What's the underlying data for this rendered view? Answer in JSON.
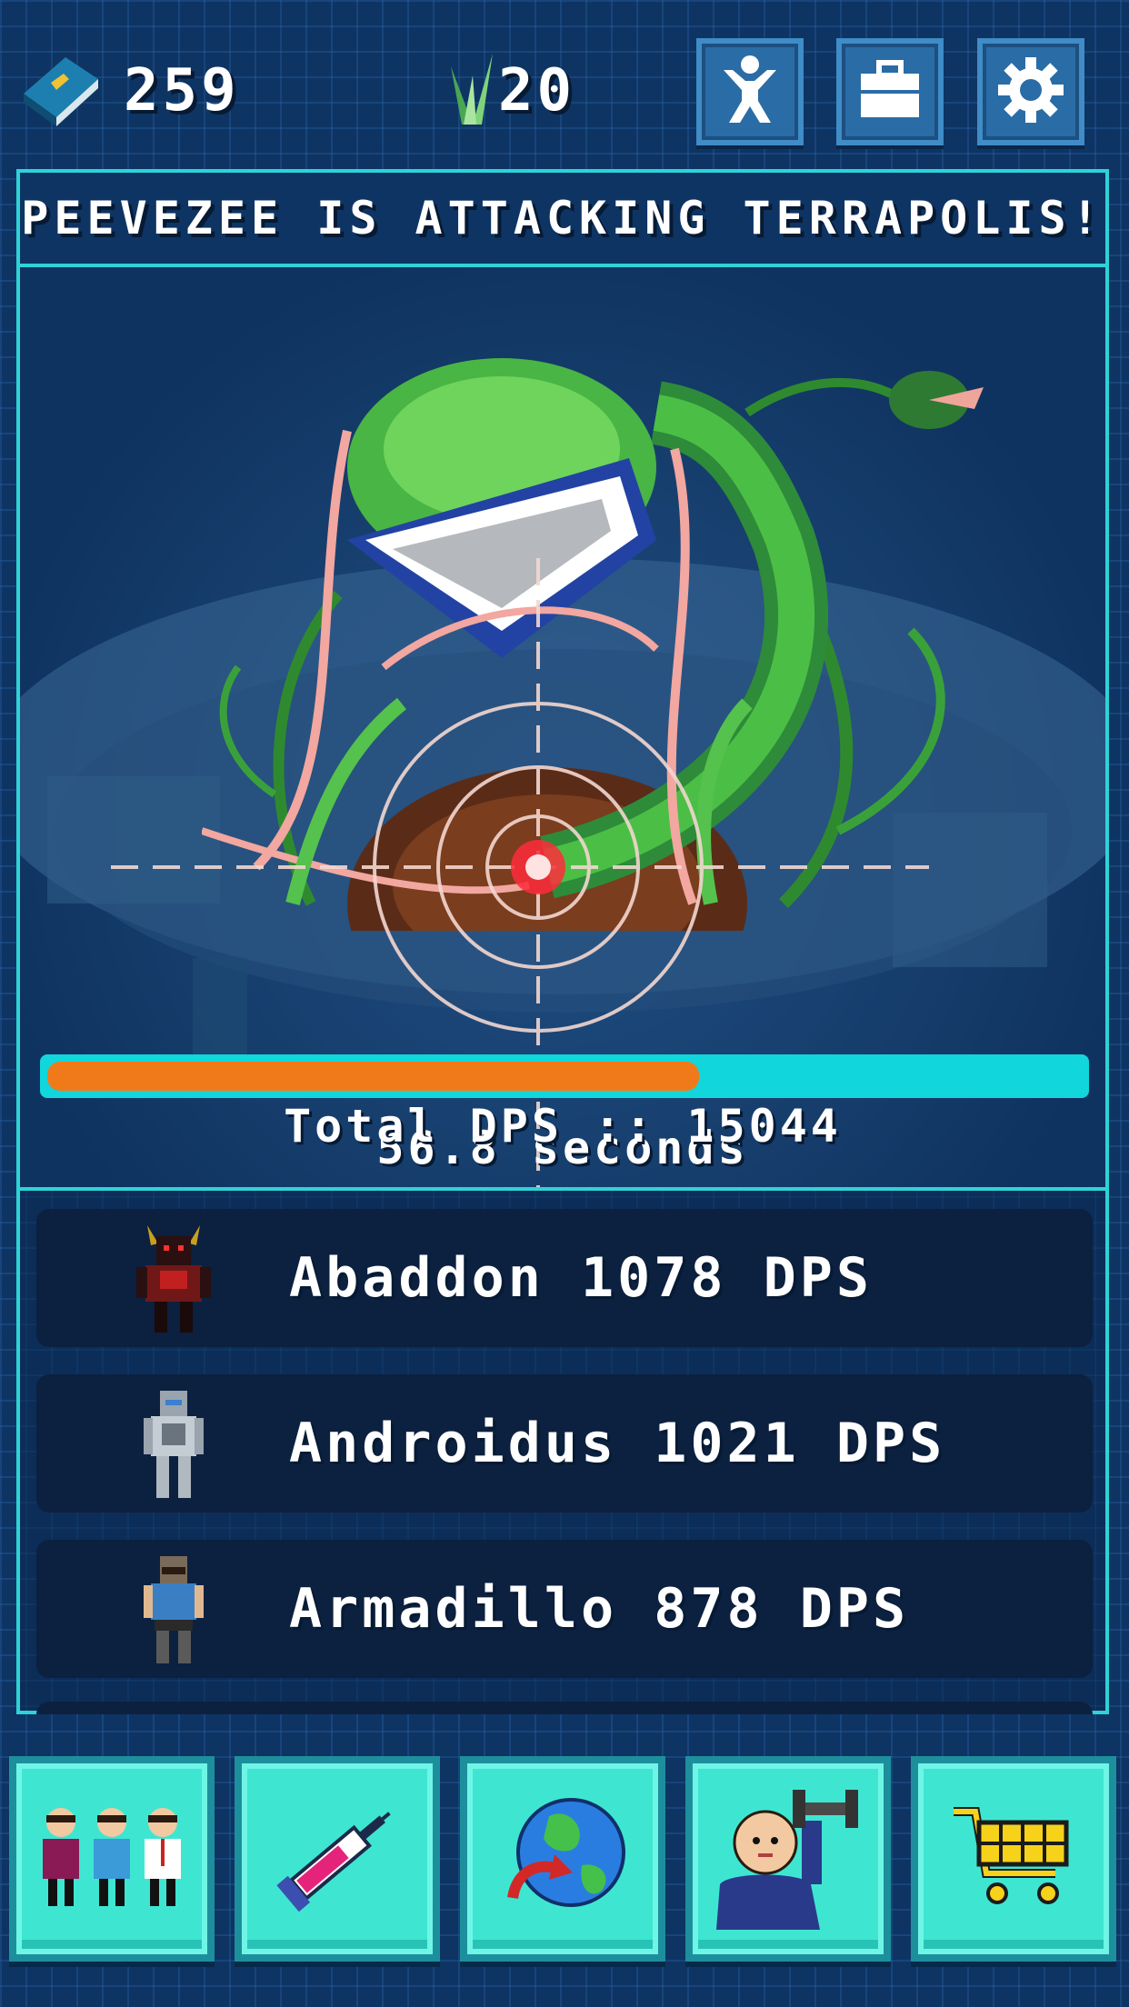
{
  "hud": {
    "book_count": "259",
    "leaf_count": "20",
    "buttons": [
      {
        "icon": "person-icon"
      },
      {
        "icon": "briefcase-icon"
      },
      {
        "icon": "gear-icon"
      }
    ]
  },
  "battle": {
    "banner": "PEEVEZEE IS ATTACKING TERRAPOLIS!",
    "health_fraction": 0.63,
    "timer_text": "56.8 seconds",
    "total_dps_text": "Total DPS :: 15044"
  },
  "heroes": [
    {
      "text": "Abaddon 1078 DPS",
      "sprite": "demon-icon"
    },
    {
      "text": "Androidus 1021 DPS",
      "sprite": "android-icon"
    },
    {
      "text": "Armadillo 878 DPS",
      "sprite": "armadillo-icon"
    }
  ],
  "nav": [
    {
      "icon": "team-icon"
    },
    {
      "icon": "syringe-icon"
    },
    {
      "icon": "globe-icon"
    },
    {
      "icon": "training-icon"
    },
    {
      "icon": "cart-icon"
    }
  ],
  "colors": {
    "background": "#0e3463",
    "accent": "#2ed3d6",
    "progress_fill": "#f07a1a",
    "progress_track": "#11d6dc",
    "nav_button": "#3ee6d2"
  }
}
